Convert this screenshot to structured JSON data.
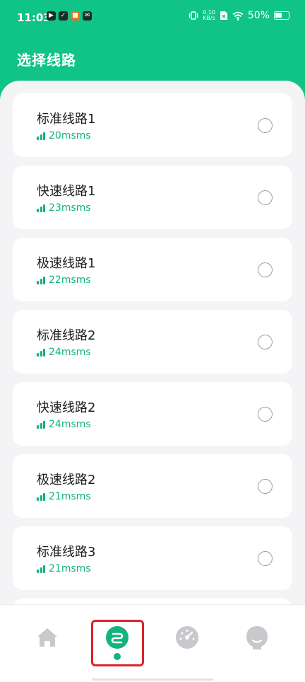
{
  "status_bar": {
    "time": "11:03",
    "app_icons": [
      "play-app-icon",
      "check-app-icon",
      "store-app-icon",
      "mail-app-icon"
    ],
    "net_speed_value": "0.10",
    "net_speed_unit": "KB/s",
    "battery": "50%"
  },
  "header": {
    "title": "选择线路"
  },
  "routes": [
    {
      "name": "标准线路1",
      "latency": "20msms"
    },
    {
      "name": "快速线路1",
      "latency": "23msms"
    },
    {
      "name": "极速线路1",
      "latency": "22msms"
    },
    {
      "name": "标准线路2",
      "latency": "24msms"
    },
    {
      "name": "快速线路2",
      "latency": "24msms"
    },
    {
      "name": "极速线路2",
      "latency": "21msms"
    },
    {
      "name": "标准线路3",
      "latency": "21msms"
    }
  ],
  "nav": {
    "items": [
      "home-icon",
      "route-icon",
      "speedometer-icon",
      "profile-icon"
    ],
    "active": 1
  },
  "colors": {
    "accent": "#0fc486",
    "latency": "#12b37c",
    "highlight": "#d6262c"
  }
}
